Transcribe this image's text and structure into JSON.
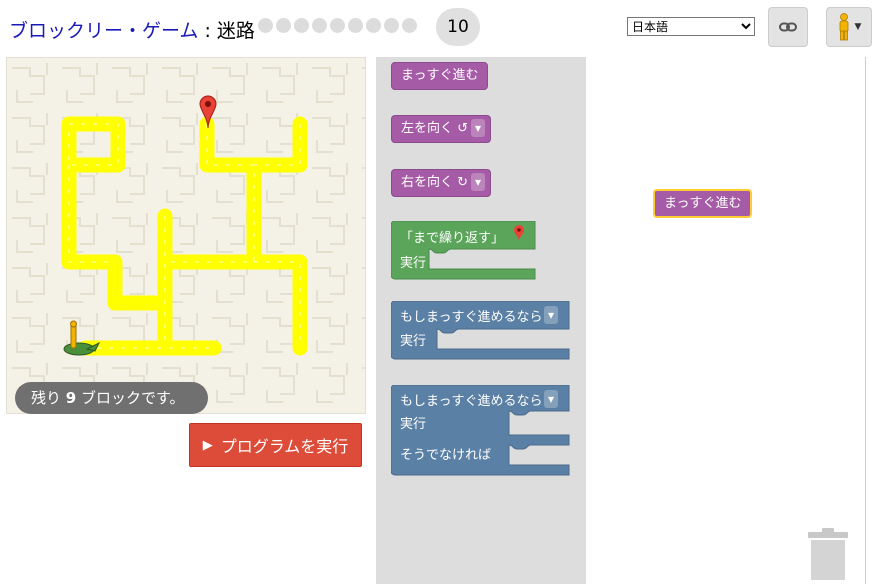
{
  "header": {
    "title_app": "ブロックリー・ゲーム",
    "title_sep": " : ",
    "title_game": "迷路",
    "level_dots": 9,
    "current_level": "10",
    "language": "日本語",
    "link_icon": "link-icon",
    "pegman_icon": "pegman-icon"
  },
  "maze": {
    "capacity_prefix": "残り ",
    "capacity_count": "9",
    "capacity_suffix": " ブロックです。"
  },
  "run_button": {
    "icon": "play-icon",
    "label": "プログラムを実行"
  },
  "toolbox": {
    "move_forward": "まっすぐ進む",
    "turn_left": "左を向く ↺",
    "turn_right": "右を向く ↻",
    "repeat_until": "「まで繰り返す」",
    "do": "実行",
    "if_path": "もしまっすぐ進めるなら",
    "if_do": "実行",
    "ifelse_path": "もしまっすぐ進めるなら",
    "ifelse_do": "実行",
    "ifelse_else": "そうでなければ"
  },
  "workspace": {
    "placed_block": "まっすぐ進む"
  },
  "colors": {
    "path": "#ffff00",
    "move_block": "#a55ba5",
    "loop_block": "#5ba55b",
    "logic_block": "#5b80a5",
    "run_button": "#dd4b39"
  }
}
